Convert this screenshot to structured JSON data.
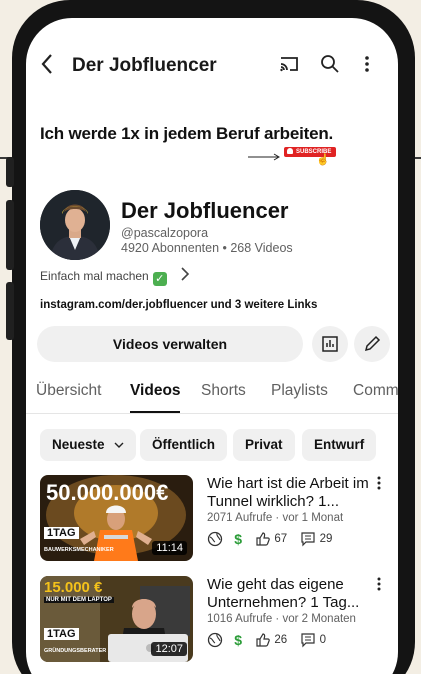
{
  "header": {
    "title": "Der Jobfluencer"
  },
  "banner": {
    "text": "Ich werde 1x in jedem Beruf arbeiten.",
    "subscribe_badge": "SUBSCRIBE"
  },
  "channel": {
    "name": "Der Jobfluencer",
    "handle": "@pascalzopora",
    "stats": "4920 Abonnenten • 268 Videos",
    "description": "Einfach mal machen",
    "links": "instagram.com/der.jobfluencer und 3 weitere Links"
  },
  "actions": {
    "manage_label": "Videos verwalten"
  },
  "tabs": [
    {
      "label": "Übersicht"
    },
    {
      "label": "Videos"
    },
    {
      "label": "Shorts"
    },
    {
      "label": "Playlists"
    },
    {
      "label": "Comm"
    }
  ],
  "filters": [
    {
      "label": "Neueste"
    },
    {
      "label": "Öffentlich"
    },
    {
      "label": "Privat"
    },
    {
      "label": "Entwurf"
    }
  ],
  "videos": [
    {
      "title": "Wie hart ist die Arbeit im Tunnel wirklich? 1...",
      "meta": "2071 Aufrufe · vor 1 Monat",
      "likes": "67",
      "comments": "29",
      "duration": "11:14",
      "thumb_big": "50.000.000€",
      "thumb_tag": "1TAG",
      "thumb_sub": "BAUWERKSMECHANIKER"
    },
    {
      "title": "Wie geht das eigene Unternehmen? 1 Tag...",
      "meta": "1016 Aufrufe · vor 2 Monaten",
      "likes": "26",
      "comments": "0",
      "duration": "12:07",
      "thumb_big": "15.000 €",
      "thumb_small": "NUR MIT DEM LAPTOP",
      "thumb_tag": "1TAG",
      "thumb_sub": "GRÜNDUNGSBERATER"
    }
  ],
  "colors": {
    "accent": "#e02323",
    "text": "#111111",
    "secondary": "#606060",
    "chip_bg": "#f0f0f0"
  }
}
